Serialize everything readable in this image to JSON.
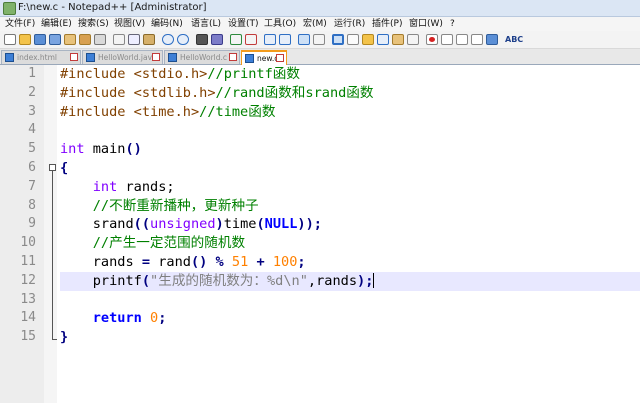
{
  "window": {
    "title": "F:\\new.c - Notepad++ [Administrator]"
  },
  "menu": [
    {
      "id": "file",
      "label": "文件(F)"
    },
    {
      "id": "edit",
      "label": "编辑(E)"
    },
    {
      "id": "search",
      "label": "搜索(S)"
    },
    {
      "id": "view",
      "label": "视图(V)"
    },
    {
      "id": "encoding",
      "label": "编码(N)"
    },
    {
      "id": "language",
      "label": "语言(L)"
    },
    {
      "id": "settings",
      "label": "设置(T)"
    },
    {
      "id": "tools",
      "label": "工具(O)"
    },
    {
      "id": "macro",
      "label": "宏(M)"
    },
    {
      "id": "run",
      "label": "运行(R)"
    },
    {
      "id": "plugins",
      "label": "插件(P)"
    },
    {
      "id": "window",
      "label": "窗口(W)"
    },
    {
      "id": "help",
      "label": "?"
    }
  ],
  "toolbar": {
    "icons": [
      "new-file-icon",
      "open-file-icon",
      "save-icon",
      "save-all-icon",
      "close-icon",
      "close-all-icon",
      "print-icon",
      "cut-icon",
      "copy-icon",
      "paste-icon",
      "undo-icon",
      "redo-icon",
      "find-icon",
      "replace-icon",
      "zoom-in-icon",
      "zoom-out-icon",
      "sync-vertical-icon",
      "sync-horizontal-icon",
      "word-wrap-icon",
      "show-all-chars-icon",
      "indent-guide-icon",
      "user-language-icon",
      "doc-map-icon",
      "function-list-icon",
      "folder-workspace-icon",
      "monitoring-icon",
      "record-macro-icon",
      "stop-record-icon",
      "play-macro-icon",
      "run-macro-multiple-icon",
      "save-macro-icon",
      "spell-check-icon"
    ],
    "spell_check_label": "ABC",
    "colors": {
      "record": "#d62222",
      "accent": "#2f6fc4"
    }
  },
  "tabs": [
    {
      "label": "index.html",
      "active": false
    },
    {
      "label": "HelloWorld.java",
      "active": false
    },
    {
      "label": "HelloWorld.c",
      "active": false
    },
    {
      "label": "new.c",
      "active": true
    }
  ],
  "editor": {
    "line_numbers": [
      "1",
      "2",
      "3",
      "4",
      "5",
      "6",
      "7",
      "8",
      "9",
      "10",
      "11",
      "12",
      "13",
      "14",
      "15"
    ],
    "current_line": 12,
    "code": {
      "l1": {
        "directive": "#include <stdio.h>",
        "comment": "//printf函数"
      },
      "l2": {
        "directive": "#include <stdlib.h>",
        "comment": "//rand函数和srand函数"
      },
      "l3": {
        "directive": "#include <time.h>",
        "comment": "//time函数"
      },
      "l5": {
        "type": "int",
        "rest": " main",
        "parens": "()"
      },
      "l6": {
        "brace": "{"
      },
      "l7": {
        "indent": "    ",
        "type": "int",
        "rest": " rands;"
      },
      "l8": {
        "indent": "    ",
        "comment": "//不断重新播种，更新种子"
      },
      "l9": {
        "indent": "    ",
        "fn": "srand",
        "p1": "((",
        "cast": "unsigned",
        "p2": ")",
        "fn2": "time",
        "p3": "(",
        "null": "NULL",
        "p4": "));"
      },
      "l10": {
        "indent": "    ",
        "comment": "//产生一定范围的随机数"
      },
      "l11": {
        "indent": "    ",
        "lhs": "rands ",
        "eq": "=",
        "rand": " rand",
        "parens": "()",
        "sp1": " ",
        "mod": "%",
        "sp2": " ",
        "n1": "51",
        "sp3": " ",
        "plus": "+",
        "sp4": " ",
        "n2": "100",
        "semi": ";"
      },
      "l12": {
        "indent": "    ",
        "fn": "printf",
        "p1": "(",
        "str": "\"生成的随机数为：%d\\n\"",
        "rest": ",rands",
        "p2": ");"
      },
      "l14": {
        "indent": "    ",
        "kw": "return",
        "sp": " ",
        "num": "0",
        "semi": ";"
      },
      "l15": {
        "brace": "}"
      }
    }
  }
}
